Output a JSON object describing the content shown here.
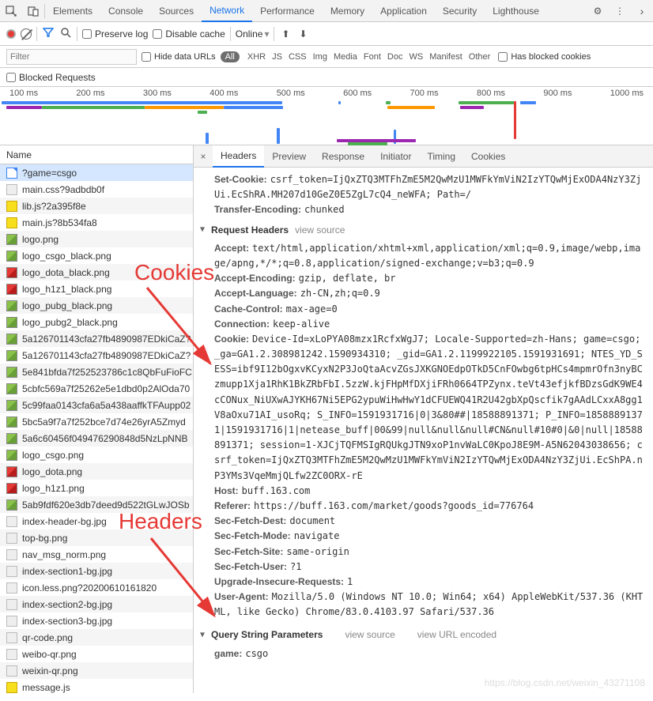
{
  "topTabs": [
    "Elements",
    "Console",
    "Sources",
    "Network",
    "Performance",
    "Memory",
    "Application",
    "Security",
    "Lighthouse"
  ],
  "activeTopTab": 3,
  "toolbar": {
    "preserve_log": "Preserve log",
    "disable_cache": "Disable cache",
    "online": "Online"
  },
  "filterBar": {
    "placeholder": "Filter",
    "hide_data_urls": "Hide data URLs",
    "all": "All",
    "types": [
      "XHR",
      "JS",
      "CSS",
      "Img",
      "Media",
      "Font",
      "Doc",
      "WS",
      "Manifest",
      "Other"
    ],
    "has_blocked": "Has blocked cookies"
  },
  "blocked_requests": "Blocked Requests",
  "timeLabels": [
    "100 ms",
    "200 ms",
    "300 ms",
    "400 ms",
    "500 ms",
    "600 ms",
    "700 ms",
    "800 ms",
    "900 ms",
    "1000 ms"
  ],
  "nameHeader": "Name",
  "files": [
    {
      "name": "?game=csgo",
      "icon": "doc-blue",
      "sel": true
    },
    {
      "name": "main.css?9adbdb0f",
      "icon": "gray"
    },
    {
      "name": "lib.js?2a395f8e",
      "icon": "js",
      "alt": true
    },
    {
      "name": "main.js?8b534fa8",
      "icon": "js"
    },
    {
      "name": "logo.png",
      "icon": "img",
      "alt": true
    },
    {
      "name": "logo_csgo_black.png",
      "icon": "img"
    },
    {
      "name": "logo_dota_black.png",
      "icon": "imgr",
      "alt": true
    },
    {
      "name": "logo_h1z1_black.png",
      "icon": "imgr"
    },
    {
      "name": "logo_pubg_black.png",
      "icon": "img",
      "alt": true
    },
    {
      "name": "logo_pubg2_black.png",
      "icon": "img"
    },
    {
      "name": "5a126701143cfa27fb4890987EDkiCaZ?",
      "icon": "img",
      "alt": true
    },
    {
      "name": "5a126701143cfa27fb4890987EDkiCaZ?",
      "icon": "img"
    },
    {
      "name": "5e841bfda7f252523786c1c8QbFuFioFC",
      "icon": "img",
      "alt": true
    },
    {
      "name": "5cbfc569a7f25262e5e1dbd0p2AlOda70",
      "icon": "img"
    },
    {
      "name": "5c99faa0143cfa6a5a438aaffkTFAupp02",
      "icon": "img",
      "alt": true
    },
    {
      "name": "5bc5a9f7a7f252bce7d74e26yrA5Zmyd",
      "icon": "img"
    },
    {
      "name": "5a6c60456f049476290848d5NzLpNNB",
      "icon": "img",
      "alt": true
    },
    {
      "name": "logo_csgo.png",
      "icon": "img"
    },
    {
      "name": "logo_dota.png",
      "icon": "imgr",
      "alt": true
    },
    {
      "name": "logo_h1z1.png",
      "icon": "imgr"
    },
    {
      "name": "5ab9fdf620e3db7deed9d522tGLwJOSb",
      "icon": "img",
      "alt": true
    },
    {
      "name": "index-header-bg.jpg",
      "icon": "gray"
    },
    {
      "name": "top-bg.png",
      "icon": "gray",
      "alt": true
    },
    {
      "name": "nav_msg_norm.png",
      "icon": "gray"
    },
    {
      "name": "index-section1-bg.jpg",
      "icon": "gray",
      "alt": true
    },
    {
      "name": "icon.less.png?20200610161820",
      "icon": "gray"
    },
    {
      "name": "index-section2-bg.jpg",
      "icon": "gray",
      "alt": true
    },
    {
      "name": "index-section3-bg.jpg",
      "icon": "gray"
    },
    {
      "name": "qr-code.png",
      "icon": "gray",
      "alt": true
    },
    {
      "name": "weibo-qr.png",
      "icon": "gray"
    },
    {
      "name": "weixin-qr.png",
      "icon": "gray",
      "alt": true
    },
    {
      "name": "message.js",
      "icon": "js"
    }
  ],
  "rightTabs": [
    "Headers",
    "Preview",
    "Response",
    "Initiator",
    "Timing",
    "Cookies"
  ],
  "activeRightTab": 0,
  "headers": {
    "set_cookie_k": "Set-Cookie:",
    "set_cookie_v": "csrf_token=IjQxZTQ3MTFhZmE5M2QwMzU1MWFkYmViN2IzYTQwMjExODA4NzY3ZjUi.EcShRA.MH207d10GeZ0E5ZgL7cQ4_neWFA; Path=/",
    "transfer_k": "Transfer-Encoding:",
    "transfer_v": "chunked",
    "req_headers": "Request Headers",
    "view_source": "view source",
    "accept_k": "Accept:",
    "accept_v": "text/html,application/xhtml+xml,application/xml;q=0.9,image/webp,image/apng,*/*;q=0.8,application/signed-exchange;v=b3;q=0.9",
    "enc_k": "Accept-Encoding:",
    "enc_v": "gzip, deflate, br",
    "lang_k": "Accept-Language:",
    "lang_v": "zh-CN,zh;q=0.9",
    "cache_k": "Cache-Control:",
    "cache_v": "max-age=0",
    "conn_k": "Connection:",
    "conn_v": "keep-alive",
    "cookie_k": "Cookie:",
    "cookie_v": "Device-Id=xLoPYA08mzx1RcfxWgJ7; Locale-Supported=zh-Hans; game=csgo; _ga=GA1.2.308981242.1590934310; _gid=GA1.2.1199922105.1591931691; NTES_YD_SESS=ibf9I12bOgxvKCyxN2P3JoQtaAcvZGsJXKGNOEdpOTkD5CnFOwbg6tpHCs4mpmrOfn3nyBCzmupp1Xja1RhK1BkZRbFbI.5zzW.kjFHpMfDXjiFRh0664TPZynx.teVt43efjkfBDzsGdK9WE4cCONux_NiUXwAJYKH67Ni5EPG2ypuWiHwHwY1dCFUEWQ41R2U42gbXpQscfik7gAAdLCxxA8gg1V8aOxu71AI_usoRq; S_INFO=1591931716|0|3&80##|18588891371; P_INFO=18588891371|1591931716|1|netease_buff|00&99|null&null&null#CN&null#10#0|&0|null|18588891371; session=1-XJCjTQFMSIgRQUkgJTN9xoP1nvWaLC0KpoJ8E9M-A5N62043038656; csrf_token=IjQxZTQ3MTFhZmE5M2QwMzU1MWFkYmViN2IzYTQwMjExODA4NzY3ZjUi.EcShPA.nP3YMs3VqeMmjQLfw2ZC0ORX-rE",
    "host_k": "Host:",
    "host_v": "buff.163.com",
    "ref_k": "Referer:",
    "ref_v": "https://buff.163.com/market/goods?goods_id=776764",
    "sfd_k": "Sec-Fetch-Dest:",
    "sfd_v": "document",
    "sfm_k": "Sec-Fetch-Mode:",
    "sfm_v": "navigate",
    "sfs_k": "Sec-Fetch-Site:",
    "sfs_v": "same-origin",
    "sfu_k": "Sec-Fetch-User:",
    "sfu_v": "?1",
    "uir_k": "Upgrade-Insecure-Requests:",
    "uir_v": "1",
    "ua_k": "User-Agent:",
    "ua_v": "Mozilla/5.0 (Windows NT 10.0; Win64; x64) AppleWebKit/537.36 (KHTML, like Gecko) Chrome/83.0.4103.97 Safari/537.36",
    "qsp": "Query String Parameters",
    "view_url": "view URL encoded",
    "game_k": "game:",
    "game_v": "csgo"
  },
  "annotations": {
    "cookies": "Cookies",
    "headers": "Headers"
  },
  "watermark": "https://blog.csdn.net/weixin_43271108"
}
